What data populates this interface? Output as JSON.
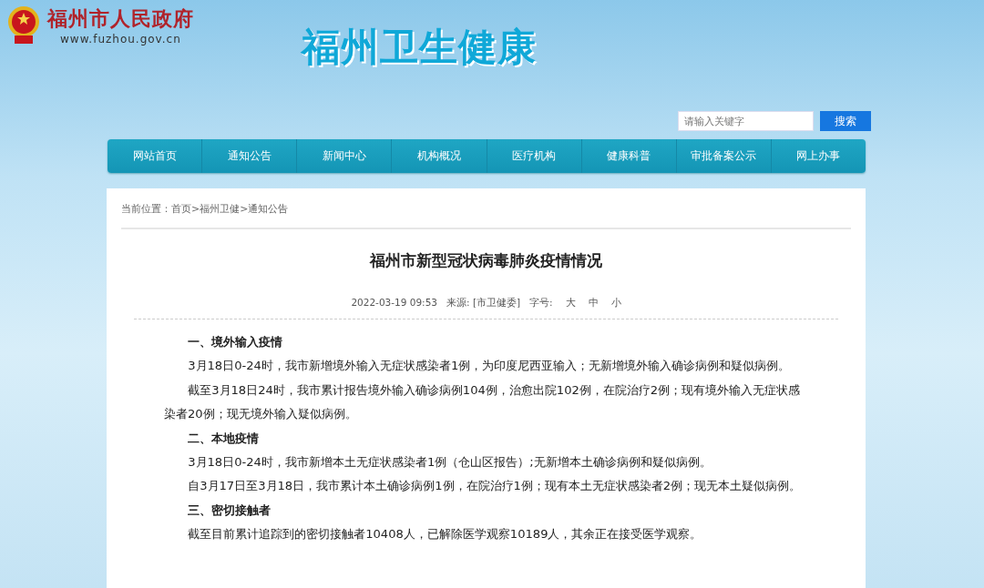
{
  "header": {
    "gov_name": "福州市人民政府",
    "gov_url": "www.fuzhou.gov.cn",
    "site_title": "福州卫生健康"
  },
  "search": {
    "placeholder": "请输入关键字",
    "button": "搜索"
  },
  "nav": [
    {
      "label": "网站首页"
    },
    {
      "label": "通知公告"
    },
    {
      "label": "新闻中心"
    },
    {
      "label": "机构概况"
    },
    {
      "label": "医疗机构"
    },
    {
      "label": "健康科普"
    },
    {
      "label": "审批备案公示"
    },
    {
      "label": "网上办事"
    }
  ],
  "breadcrumb": {
    "label": "当前位置：",
    "items": [
      {
        "text": "首页",
        "separator": ">"
      },
      {
        "text": "福州卫健",
        "separator": ">"
      },
      {
        "text": "通知公告"
      }
    ]
  },
  "article": {
    "title": "福州市新型冠状病毒肺炎疫情情况",
    "date": "2022-03-19 09:53",
    "source": "来源: [市卫健委]",
    "font_size_label": "字号:",
    "font_sizes": [
      "大",
      "中",
      "小"
    ],
    "body": [
      {
        "kind": "heading",
        "text": "一、境外输入疫情"
      },
      {
        "kind": "paragraph",
        "text": "3月18日0-24时，我市新增境外输入无症状感染者1例，为印度尼西亚输入；无新增境外输入确诊病例和疑似病例。"
      },
      {
        "kind": "paragraph",
        "text": "截至3月18日24时，我市累计报告境外输入确诊病例104例，治愈出院102例，在院治疗2例；现有境外输入无症状感染者20例；现无境外输入疑似病例。"
      },
      {
        "kind": "heading",
        "text": "二、本地疫情"
      },
      {
        "kind": "paragraph",
        "text": "3月18日0-24时，我市新增本土无症状感染者1例（仓山区报告）;无新增本土确诊病例和疑似病例。"
      },
      {
        "kind": "paragraph",
        "text": "自3月17日至3月18日，我市累计本土确诊病例1例，在院治疗1例；现有本土无症状感染者2例；现无本土疑似病例。"
      },
      {
        "kind": "heading",
        "text": "三、密切接触者"
      },
      {
        "kind": "paragraph",
        "text": "截至目前累计追踪到的密切接触者10408人，已解除医学观察10189人，其余正在接受医学观察。"
      }
    ]
  }
}
